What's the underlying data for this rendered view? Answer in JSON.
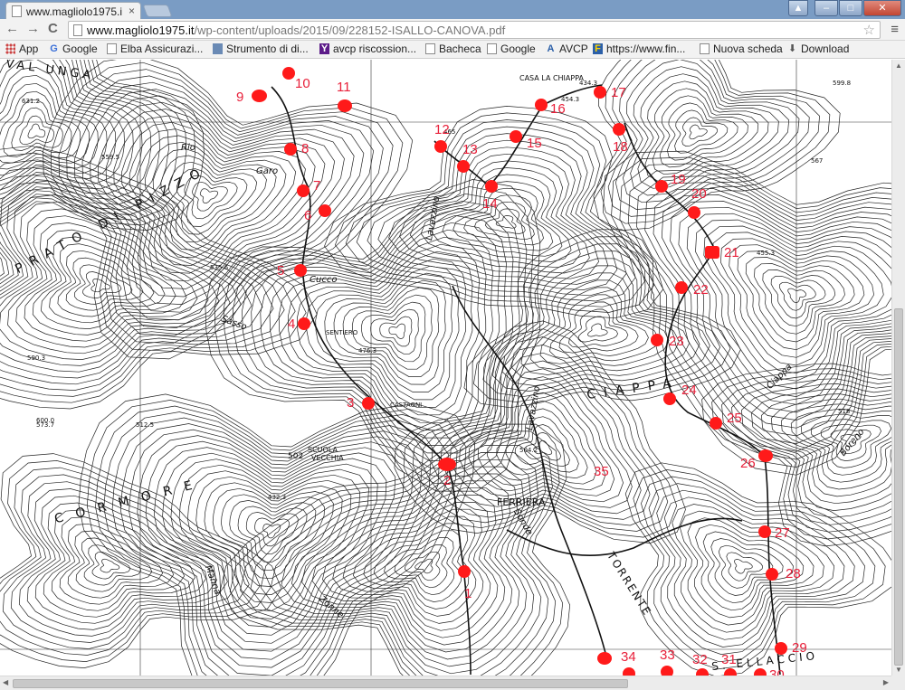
{
  "tab": {
    "title": "www.magliolo1975.i",
    "close": "×"
  },
  "window_buttons": {
    "user": "▲",
    "minimize": "–",
    "maximize": "□",
    "close": "✕"
  },
  "address": {
    "host": "www.magliolo1975.it",
    "path": "/wp-content/uploads/2015/09/228152-ISALLO-CANOVA.pdf",
    "back": "←",
    "forward": "→",
    "reload": "C",
    "star": "☆",
    "menu": "≡"
  },
  "bookmarks": [
    {
      "label": "App",
      "icon": "apps-grid-icon"
    },
    {
      "label": "Google",
      "icon": "google-icon"
    },
    {
      "label": "Elba Assicurazi...",
      "icon": "page-icon"
    },
    {
      "label": "Strumento di di...",
      "icon": "document-icon"
    },
    {
      "label": "avcp riscossion...",
      "icon": "yahoo-icon"
    },
    {
      "label": "Bacheca",
      "icon": "page-icon"
    },
    {
      "label": "Google",
      "icon": "page-icon"
    },
    {
      "label": "AVCP",
      "icon": "avcp-icon"
    },
    {
      "label": "https://www.fin...",
      "icon": "f-icon"
    },
    {
      "label": "Nuova scheda",
      "icon": "page-icon"
    },
    {
      "label": "Download",
      "icon": "download-icon"
    }
  ],
  "map": {
    "place_labels": [
      {
        "text": "VAL UNGA"
      },
      {
        "text": "CASA LA CHIAPPA"
      },
      {
        "text": "PRATO DI PIZZO"
      },
      {
        "text": "CIAPPA"
      },
      {
        "text": "CORMORE"
      },
      {
        "text": "FERRIERA"
      },
      {
        "text": "SCUOLA"
      },
      {
        "text": "VECCHIA"
      },
      {
        "text": "CASTAGNI"
      },
      {
        "text": "SENTIERO"
      },
      {
        "text": "TORRENTE"
      },
      {
        "text": "S. ELLACCIO"
      },
      {
        "text": "Sasso"
      },
      {
        "text": "Cucco"
      },
      {
        "text": "Garo"
      },
      {
        "text": "Rio"
      },
      {
        "text": "Lavazzino"
      },
      {
        "text": "Lavazzino"
      },
      {
        "text": "Boreno"
      },
      {
        "text": "Ciappa"
      },
      {
        "text": "Zonne"
      },
      {
        "text": "Manna"
      },
      {
        "text": "Sonde"
      }
    ],
    "elevations": [
      "631.2",
      "559.5",
      "535.6",
      "573.7",
      "590.3",
      "512.5",
      "504.2",
      "432.3",
      "502",
      "476.3",
      "465",
      "454.3",
      "434.3",
      "455.3",
      "518",
      "567",
      "600.0",
      "599.8"
    ],
    "markers": [
      "1",
      "2",
      "3",
      "4",
      "5",
      "6",
      "7",
      "8",
      "9",
      "10",
      "11",
      "12",
      "13",
      "14",
      "15",
      "16",
      "17",
      "18",
      "19",
      "20",
      "21",
      "22",
      "23",
      "24",
      "25",
      "26",
      "27",
      "28",
      "29",
      "30",
      "31",
      "32",
      "33",
      "34",
      "35"
    ],
    "colors": {
      "marker": "#ff1a1a",
      "marker_label": "#e8203a"
    }
  }
}
